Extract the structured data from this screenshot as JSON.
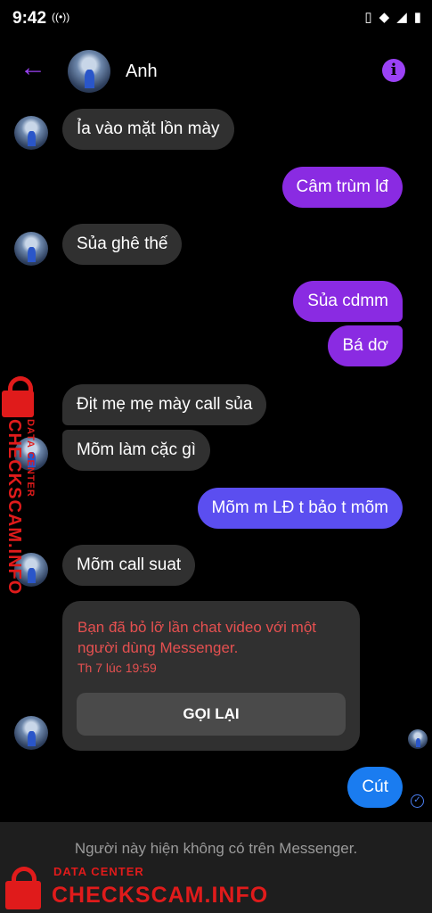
{
  "status_bar": {
    "time": "9:42"
  },
  "header": {
    "name": "Anh",
    "back_icon": "arrow-left-icon",
    "info_icon": "info-icon",
    "accent": "#9b42f5"
  },
  "messages": [
    {
      "dir": "in",
      "text": "Ỉa vào mặt lồn mày"
    },
    {
      "dir": "out",
      "text": "Câm trùm lđ"
    },
    {
      "dir": "in",
      "text": "Sủa ghê thế"
    },
    {
      "dir": "out",
      "text": "Sủa cdmm"
    },
    {
      "dir": "out",
      "text": "Bá dơ"
    },
    {
      "dir": "in",
      "text": "Địt mẹ mẹ mày call sủa"
    },
    {
      "dir": "in",
      "text": "Mõm làm cặc gì"
    },
    {
      "dir": "out",
      "text": "Mõm m LĐ t bảo t mõm"
    },
    {
      "dir": "in",
      "text": "Mõm call suat"
    },
    {
      "dir": "out",
      "text": "Cút"
    }
  ],
  "missed_call": {
    "text": "Bạn đã bỏ lỡ lần chat video với một người dùng Messenger.",
    "time": "Th 7 lúc 19:59",
    "button": "GỌI LẠI"
  },
  "footer": {
    "notice": "Người này hiện không có trên Messenger."
  },
  "watermark": {
    "line1": "DATA CENTER",
    "line2": "CHECKSCAM.INFO",
    "color": "#e01b1b"
  }
}
